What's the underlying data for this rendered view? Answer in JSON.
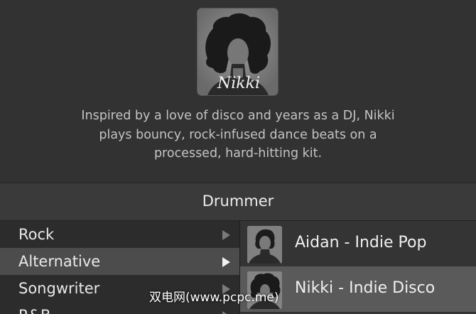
{
  "drummer_profile": {
    "portrait_icon": "afro-hair-silhouette-icon",
    "portrait_signature": "Nikki",
    "description_lines": [
      "Inspired by a love of disco and years as a DJ, Nikki",
      "plays bouncy, rock-infused dance beats on a",
      "processed, hard-hitting kit."
    ]
  },
  "header": {
    "title": "Drummer"
  },
  "genres": [
    {
      "label": "Rock",
      "selected": false
    },
    {
      "label": "Alternative",
      "selected": true
    },
    {
      "label": "Songwriter",
      "selected": false
    },
    {
      "label": "R&B",
      "selected": false
    }
  ],
  "drummers": [
    {
      "label": "Aidan - Indie Pop",
      "selected": false,
      "icon": "male-silhouette-icon"
    },
    {
      "label": "Nikki - Indie Disco",
      "selected": true,
      "icon": "afro-hair-silhouette-icon"
    }
  ],
  "watermark": "双电网(www.pcpc.me)",
  "colors": {
    "background": "#2e2e2e",
    "selected_row": "#4c4c4c",
    "text": "#e9e9e9"
  }
}
